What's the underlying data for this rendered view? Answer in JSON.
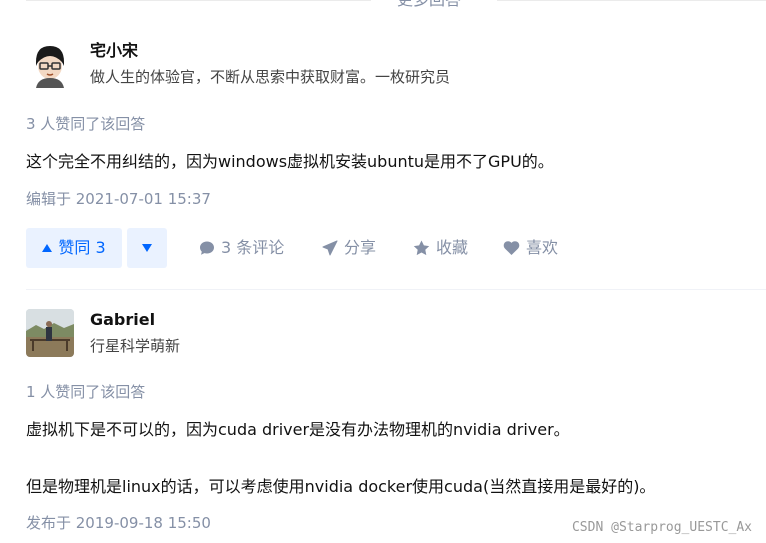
{
  "more_answers_label": "更多回答",
  "answers": [
    {
      "author": "宅小宋",
      "headline": "做人生的体验官，不断从思索中获取财富。一枚研究员",
      "votes_text": "3 人赞同了该回答",
      "content": [
        "这个完全不用纠结的，因为windows虚拟机安装ubuntu是用不了GPU的。"
      ],
      "time": "编辑于 2021-07-01 15:37",
      "actions": {
        "vote_up_label": "赞同 3",
        "comments_label": "3 条评论",
        "share_label": "分享",
        "collect_label": "收藏",
        "like_label": "喜欢"
      }
    },
    {
      "author": "Gabriel",
      "headline": "行星科学萌新",
      "votes_text": "1 人赞同了该回答",
      "content": [
        "虚拟机下是不可以的，因为cuda driver是没有办法物理机的nvidia driver。",
        "但是物理机是linux的话，可以考虑使用nvidia docker使用cuda(当然直接用是最好的)。"
      ],
      "time": "发布于 2019-09-18 15:50"
    }
  ],
  "watermark": "CSDN @Starprog_UESTC_Ax",
  "colors": {
    "accent": "#0066ff",
    "accent_bg": "#eaf2ff",
    "muted": "#8590a6"
  },
  "icons": [
    "thumbs-up-triangle-icon",
    "down-triangle-icon",
    "comment-icon",
    "share-icon",
    "star-icon",
    "heart-icon"
  ]
}
